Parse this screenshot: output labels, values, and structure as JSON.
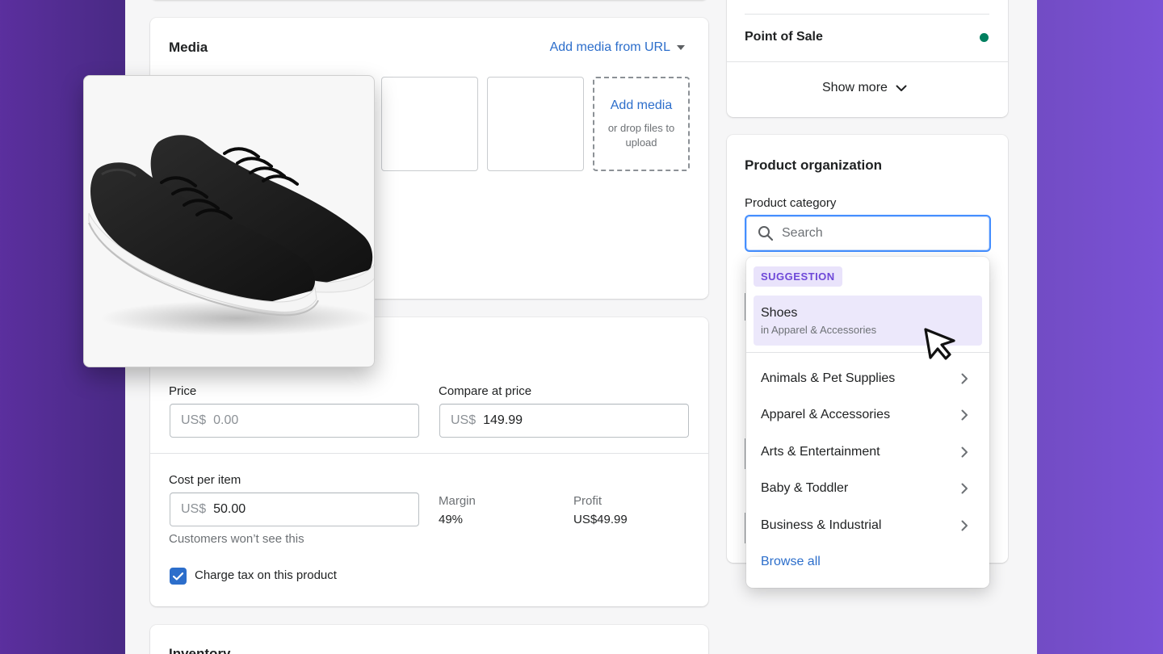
{
  "media": {
    "title": "Media",
    "add_from_url": "Add media from URL",
    "add_media_label": "Add media",
    "drop_hint": "or drop files to upload",
    "product_image": "sneaker product photo"
  },
  "pricing": {
    "price_label": "Price",
    "price_prefix": "US$",
    "price_placeholder": "0.00",
    "compare_label": "Compare at price",
    "compare_prefix": "US$",
    "compare_value": "149.99",
    "cost_label": "Cost per item",
    "cost_prefix": "US$",
    "cost_value": "50.00",
    "cost_hint": "Customers won’t see this",
    "margin_label": "Margin",
    "margin_value": "49%",
    "profit_label": "Profit",
    "profit_value": "US$49.99",
    "tax_label": "Charge tax on this product",
    "tax_checked": true
  },
  "inventory": {
    "title": "Inventory"
  },
  "sales_channels": {
    "channel_name": "Point of Sale",
    "status_color": "#007f5f",
    "show_more": "Show more"
  },
  "organization": {
    "title": "Product organization",
    "category_label": "Product category",
    "search_placeholder": "Search",
    "suggestion_badge": "SUGGESTION",
    "suggestion_name": "Shoes",
    "suggestion_path": "in Apparel & Accessories",
    "categories": [
      "Animals & Pet Supplies",
      "Apparel & Accessories",
      "Arts & Entertainment",
      "Baby & Toddler",
      "Business & Industrial"
    ],
    "browse_all": "Browse all"
  },
  "colors": {
    "accent": "#2c6ecb",
    "suggestion_bg": "#ece8fb",
    "suggestion_text": "#6e48d8",
    "focus_ring": "#458fff"
  }
}
